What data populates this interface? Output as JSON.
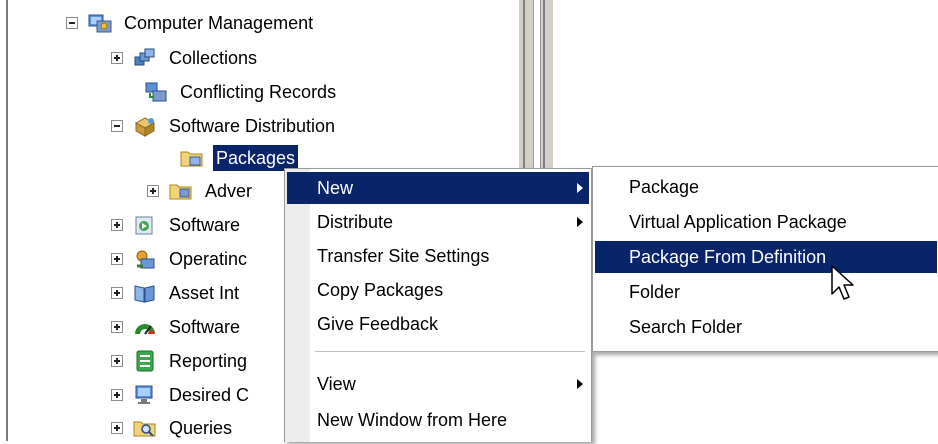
{
  "tree": {
    "root_label": "Computer Management",
    "nodes": [
      {
        "label": "Collections"
      },
      {
        "label": "Conflicting Records"
      },
      {
        "label": "Software Distribution"
      },
      {
        "label": "Packages"
      },
      {
        "label": "Adver"
      },
      {
        "label": "Software"
      },
      {
        "label": "Operatinc"
      },
      {
        "label": "Asset Int"
      },
      {
        "label": "Software"
      },
      {
        "label": "Reporting"
      },
      {
        "label": "Desired C"
      },
      {
        "label": "Queries"
      }
    ]
  },
  "context_menu": {
    "items": [
      {
        "label": "New"
      },
      {
        "label": "Distribute"
      },
      {
        "label": "Transfer Site Settings"
      },
      {
        "label": "Copy Packages"
      },
      {
        "label": "Give Feedback"
      },
      {
        "label": "View"
      },
      {
        "label": "New Window from Here"
      }
    ]
  },
  "submenu": {
    "items": [
      {
        "label": "Package"
      },
      {
        "label": "Virtual Application Package"
      },
      {
        "label": "Package From Definition"
      },
      {
        "label": "Folder"
      },
      {
        "label": "Search Folder"
      }
    ]
  }
}
